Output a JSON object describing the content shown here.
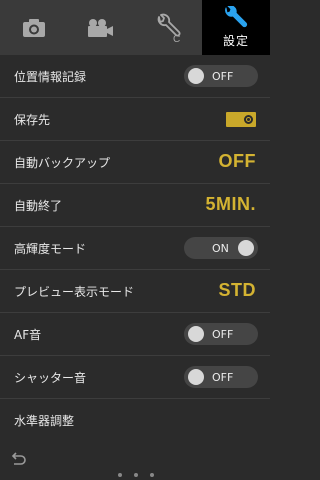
{
  "tabs": [
    {
      "icon": "camera-icon"
    },
    {
      "icon": "video-camera-icon"
    },
    {
      "icon": "custom-wrench-icon",
      "badge": "C"
    },
    {
      "icon": "wrench-icon",
      "label": "設定",
      "active": true
    }
  ],
  "settings": [
    {
      "label": "位置情報記録",
      "type": "toggle",
      "state": "off",
      "value": "OFF"
    },
    {
      "label": "保存先",
      "type": "icon",
      "icon": "memory-card-icon"
    },
    {
      "label": "自動バックアップ",
      "type": "value",
      "value": "OFF"
    },
    {
      "label": "自動終了",
      "type": "value",
      "value": "5MIN."
    },
    {
      "label": "高輝度モード",
      "type": "toggle",
      "state": "on",
      "value": "ON"
    },
    {
      "label": "プレビュー表示モード",
      "type": "value",
      "value": "STD"
    },
    {
      "label": "AF音",
      "type": "toggle",
      "state": "off",
      "value": "OFF"
    },
    {
      "label": "シャッター音",
      "type": "toggle",
      "state": "off",
      "value": "OFF"
    },
    {
      "label": "水準器調整",
      "type": "none"
    }
  ],
  "colors": {
    "accent": "#d4b332",
    "active_tab_bg": "#000000",
    "background": "#2b2b2b"
  },
  "footer": {
    "back_icon": "back-arrow-icon",
    "page_dots": 3
  }
}
